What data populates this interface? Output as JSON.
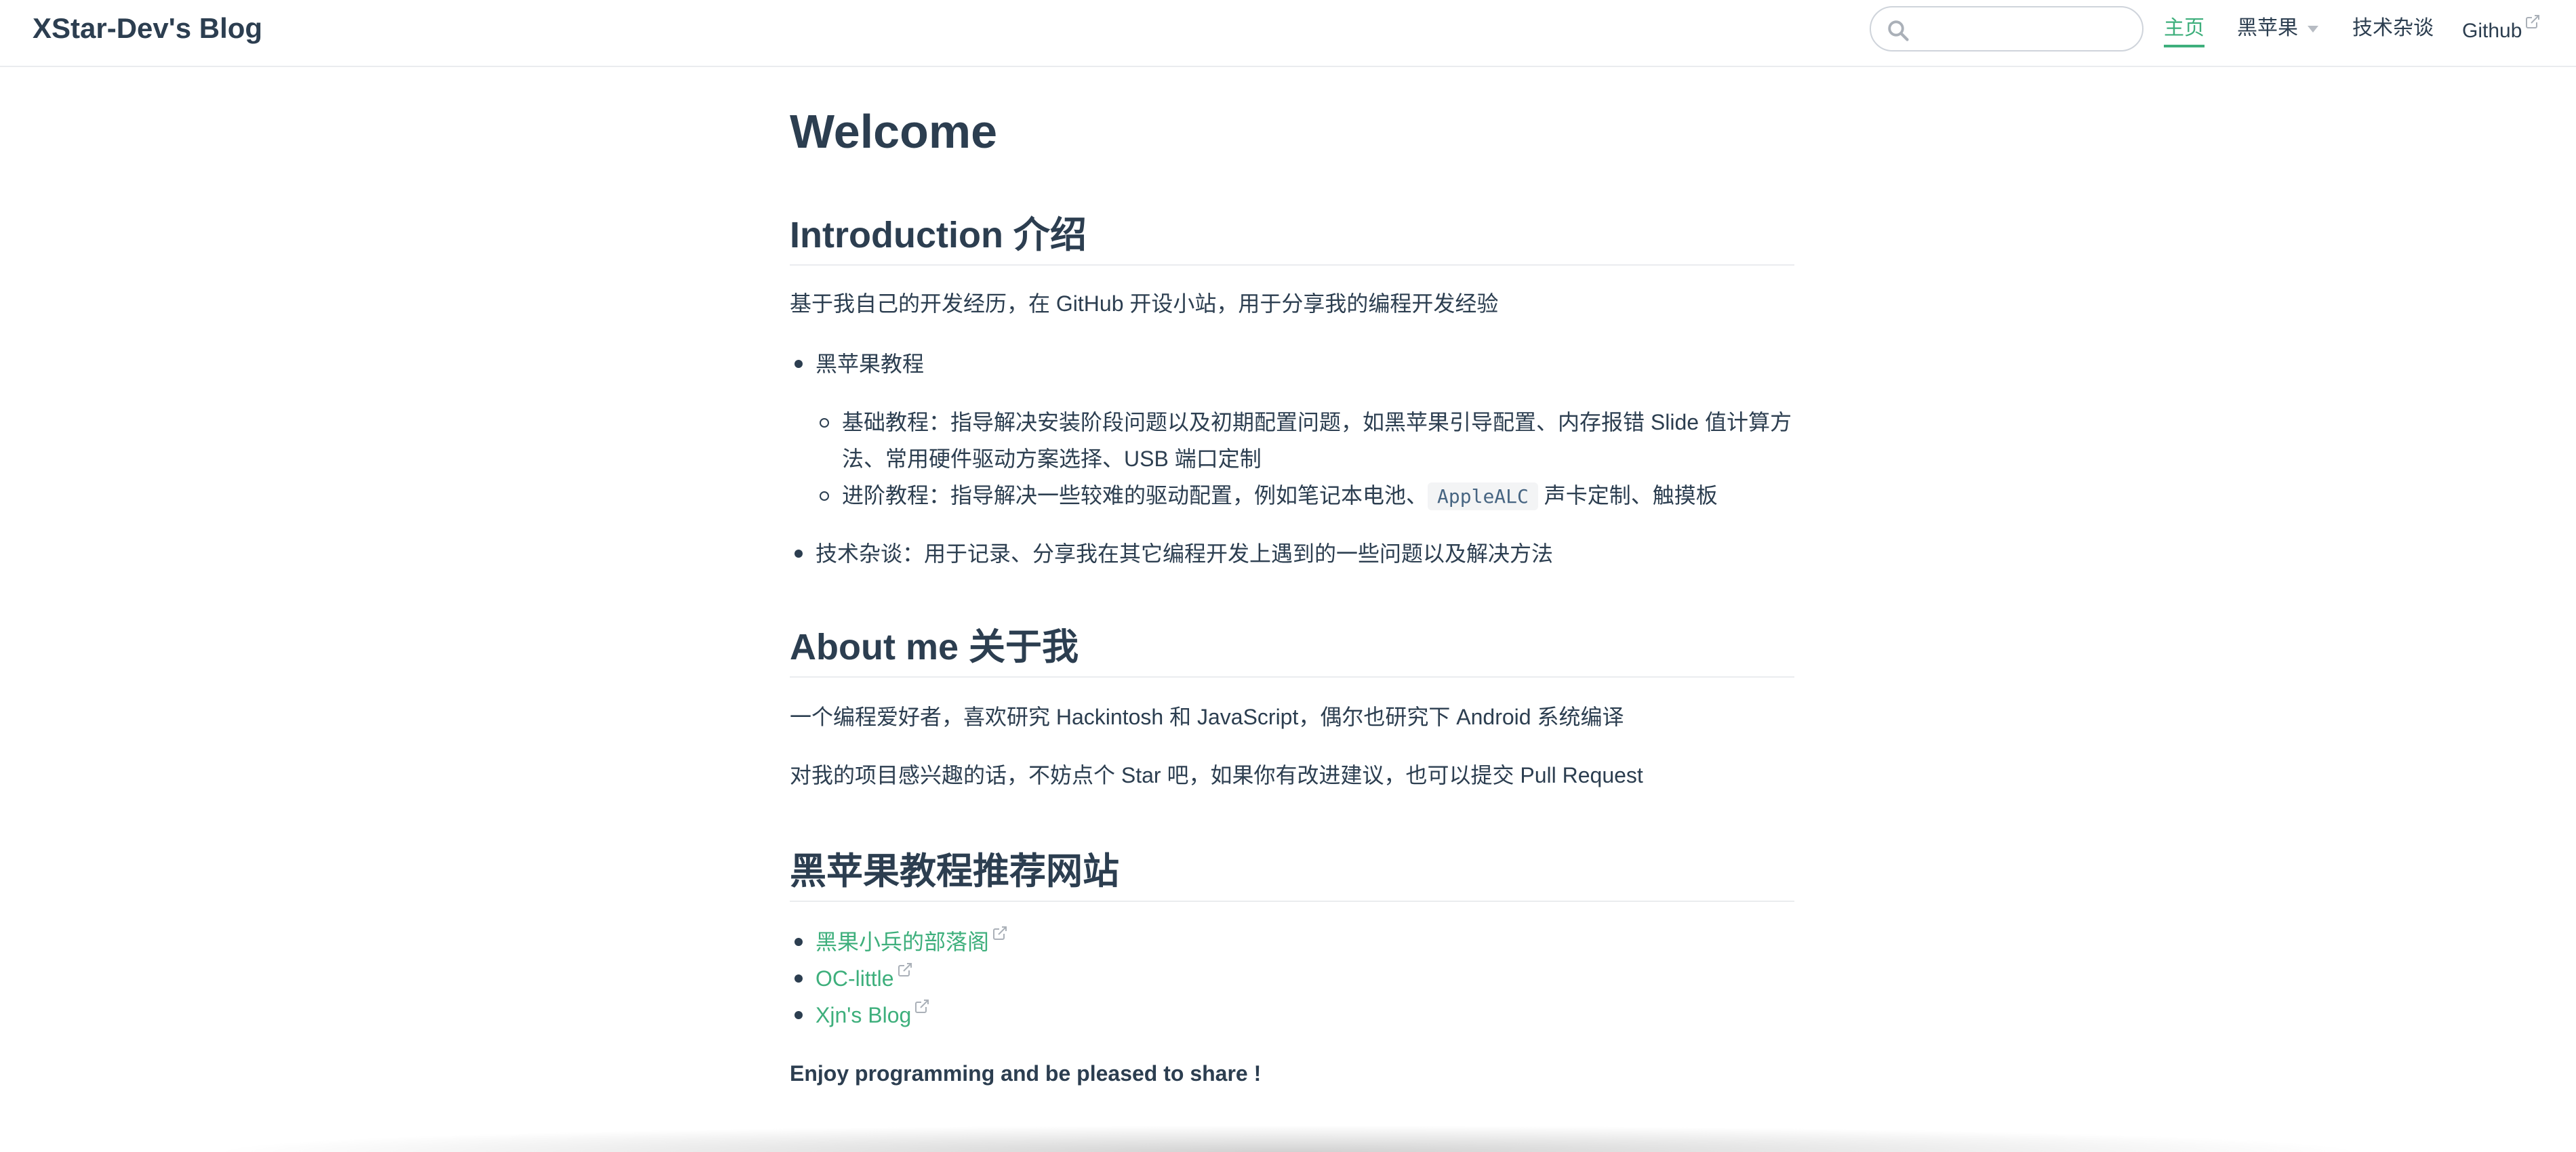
{
  "navbar": {
    "site_name": "XStar-Dev's Blog",
    "search": {
      "value": "",
      "placeholder": ""
    },
    "links": {
      "home": "主页",
      "hackintosh": "黑苹果",
      "tech": "技术杂谈",
      "github": "Github"
    },
    "active": "home"
  },
  "content": {
    "title": "Welcome",
    "intro": {
      "heading": "Introduction 介绍",
      "text": "基于我自己的开发经历，在 GitHub 开设小站，用于分享我的编程开发经验",
      "items": [
        {
          "label": "黑苹果教程",
          "sub": [
            {
              "line1": "基础教程：指导解决安装阶段问题以及初期配置问题，如黑苹果引导配置、内存报错 Slide 值计算方",
              "line2": "法、常用硬件驱动方案选择、USB 端口定制"
            },
            {
              "before": "进阶教程：指导解决一些较难的驱动配置，例如笔记本电池、",
              "code": "AppleALC",
              "after": "声卡定制、触摸板"
            }
          ]
        },
        {
          "label": "技术杂谈：用于记录、分享我在其它编程开发上遇到的一些问题以及解决方法"
        }
      ]
    },
    "about": {
      "heading": "About me 关于我",
      "line1": "一个编程爱好者，喜欢研究 Hackintosh 和 JavaScript，偶尔也研究下 Android 系统编译",
      "line2": "对我的项目感兴趣的话，不妨点个 Star 吧，如果你有改进建议，也可以提交 Pull Request"
    },
    "sites": {
      "heading": "黑苹果教程推荐网站",
      "links": [
        "黑果小兵的部落阁",
        "OC-little",
        "Xjn's Blog"
      ]
    },
    "closing": "Enjoy programming and be pleased to share !"
  },
  "colors": {
    "accent": "#3eaf7c",
    "text": "#2c3e50",
    "border": "#eaecef"
  }
}
